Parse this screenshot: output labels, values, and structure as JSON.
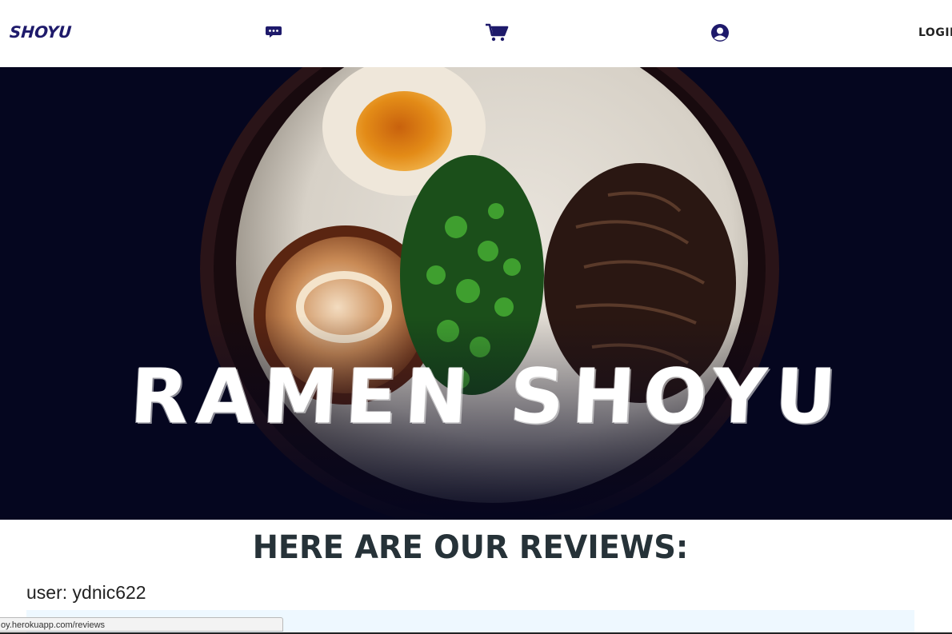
{
  "header": {
    "brand": "SHOYU",
    "login_label": "LOGIN",
    "icons": [
      "chat-icon",
      "cart-icon",
      "user-icon"
    ]
  },
  "hero": {
    "title": "RAMEN SHOYU"
  },
  "reviews": {
    "heading": "HERE ARE OUR REVIEWS:",
    "user_label": "user: ydnic622"
  },
  "status_bar": {
    "url": "oy.herokuapp.com/reviews"
  },
  "colors": {
    "brand": "#1e1a6b",
    "hero_bg": "#05061f",
    "heading": "#263238",
    "review_box": "#eef8ff"
  }
}
